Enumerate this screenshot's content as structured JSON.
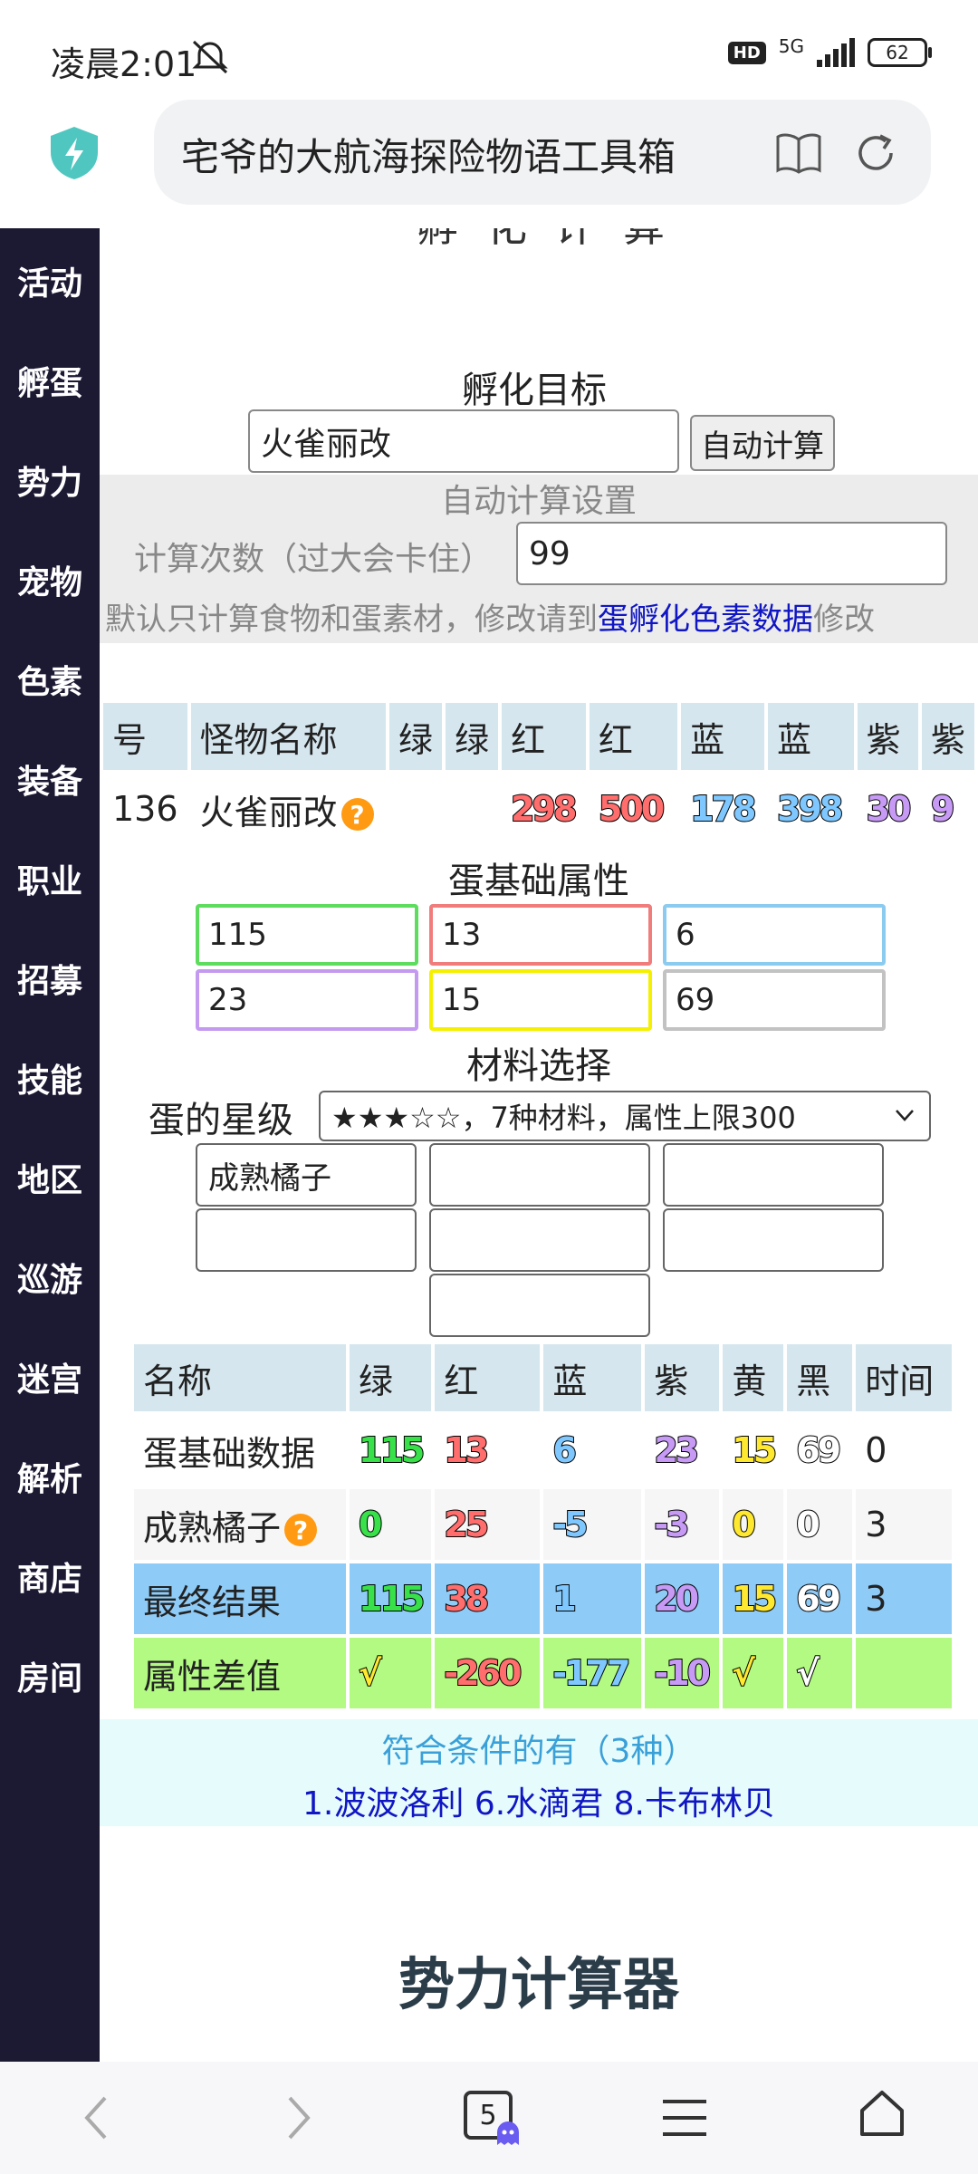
{
  "status_bar": {
    "time": "凌晨2:01",
    "hd": "HD",
    "network": "5G",
    "battery": "62"
  },
  "address_bar": {
    "title": "宅爷的大航海探险物语工具箱"
  },
  "side_nav": [
    "活动",
    "孵蛋",
    "势力",
    "宠物",
    "色素",
    "装备",
    "职业",
    "招募",
    "技能",
    "地区",
    "巡游",
    "迷宫",
    "解析",
    "商店",
    "房间"
  ],
  "hatch": {
    "section_title_partial": "孵化计算",
    "target_label": "孵化目标",
    "target_value": "火雀丽改",
    "auto_calc_button": "自动计算",
    "settings_title": "自动计算设置",
    "calc_count_label": "计算次数（过大会卡住）",
    "calc_count_value": "99",
    "note_prefix": "默认只计算食物和蛋素材，修改请到",
    "note_link": "蛋孵化色素数据",
    "note_suffix": "修改"
  },
  "monster_table": {
    "headers": [
      "号",
      "怪物名称",
      "绿",
      "绿",
      "红",
      "红",
      "蓝",
      "蓝",
      "紫",
      "紫"
    ],
    "row": {
      "id": "136",
      "name": "火雀丽改",
      "values": [
        "",
        "",
        "298",
        "500",
        "178",
        "398",
        "30",
        "9"
      ]
    }
  },
  "egg_base": {
    "title": "蛋基础属性",
    "values": [
      "115",
      "13",
      "6",
      "23",
      "15",
      "69"
    ],
    "colors": [
      "#5ddc5d",
      "#f07c7c",
      "#8ccbf0",
      "#c39af0",
      "#f5f000",
      "#c2c2c2"
    ]
  },
  "materials": {
    "title": "材料选择",
    "star_label": "蛋的星级",
    "star_value": "★★★☆☆，7种材料，属性上限300",
    "slots": [
      "成熟橘子",
      "",
      "",
      "",
      "",
      "",
      ""
    ]
  },
  "result_table": {
    "headers": [
      "名称",
      "绿",
      "红",
      "蓝",
      "紫",
      "黄",
      "黑",
      "时间"
    ],
    "rows": [
      {
        "name": "蛋基础数据",
        "values": [
          "115",
          "13",
          "6",
          "23",
          "15",
          "69"
        ],
        "time": "0"
      },
      {
        "name": "成熟橘子",
        "values": [
          "0",
          "25",
          "-5",
          "-3",
          "0",
          "0"
        ],
        "time": "3"
      },
      {
        "name": "最终结果",
        "values": [
          "115",
          "38",
          "1",
          "20",
          "15",
          "69"
        ],
        "time": "3"
      },
      {
        "name": "属性差值",
        "values": [
          "√",
          "-260",
          "-177",
          "-10",
          "√",
          "√"
        ],
        "time": ""
      }
    ]
  },
  "results": {
    "title": "符合条件的有（3种）",
    "list": "1.波波洛利 6.水滴君 8.卡布林贝"
  },
  "power_section": {
    "title": "势力计算器"
  },
  "bottom_bar": {
    "tab_count": "5"
  },
  "colors": {
    "sidebar": "#1c1933",
    "link": "#1016c4",
    "result_blue": "#8ecbf7",
    "diff_green": "#b2fa82"
  }
}
